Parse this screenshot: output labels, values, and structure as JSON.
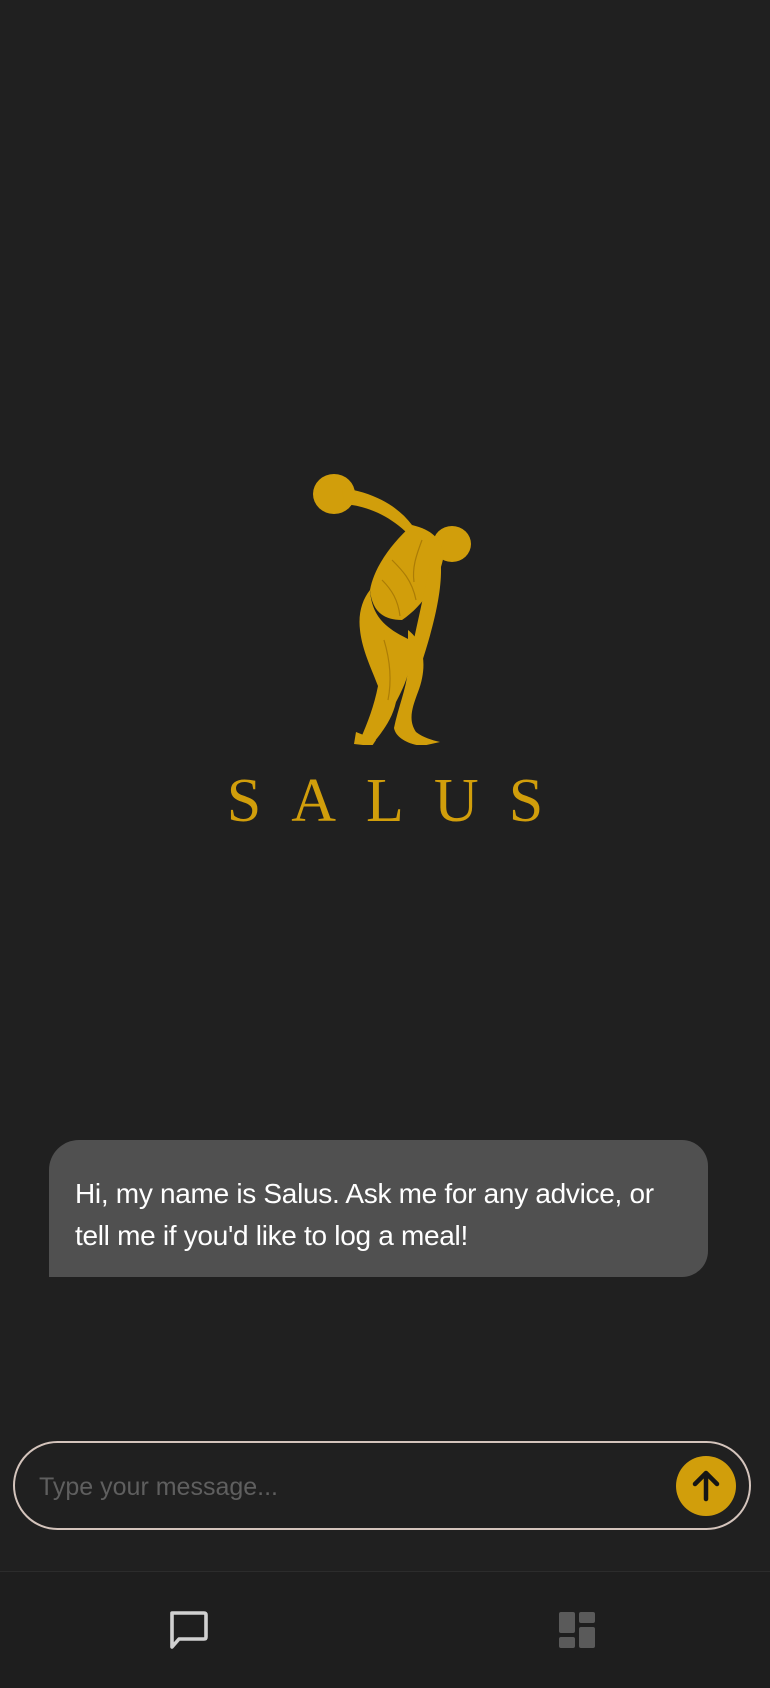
{
  "brand": {
    "name": "SALUS",
    "accent_color": "#d19e0b",
    "logo_icon": "discus-thrower-icon"
  },
  "chat": {
    "messages": [
      {
        "role": "assistant",
        "text": "Hi, my name is Salus. Ask me for any advice, or tell me if you'd like to log a meal!"
      }
    ]
  },
  "composer": {
    "placeholder": "Type your message...",
    "value": "",
    "send_icon": "arrow-up-icon"
  },
  "bottom_nav": {
    "items": [
      {
        "id": "chat",
        "icon": "chat-bubble-icon",
        "active": true,
        "color": "#d0d0d0"
      },
      {
        "id": "dashboard",
        "icon": "dashboard-icon",
        "active": false,
        "color": "#5a5a5a"
      }
    ]
  }
}
